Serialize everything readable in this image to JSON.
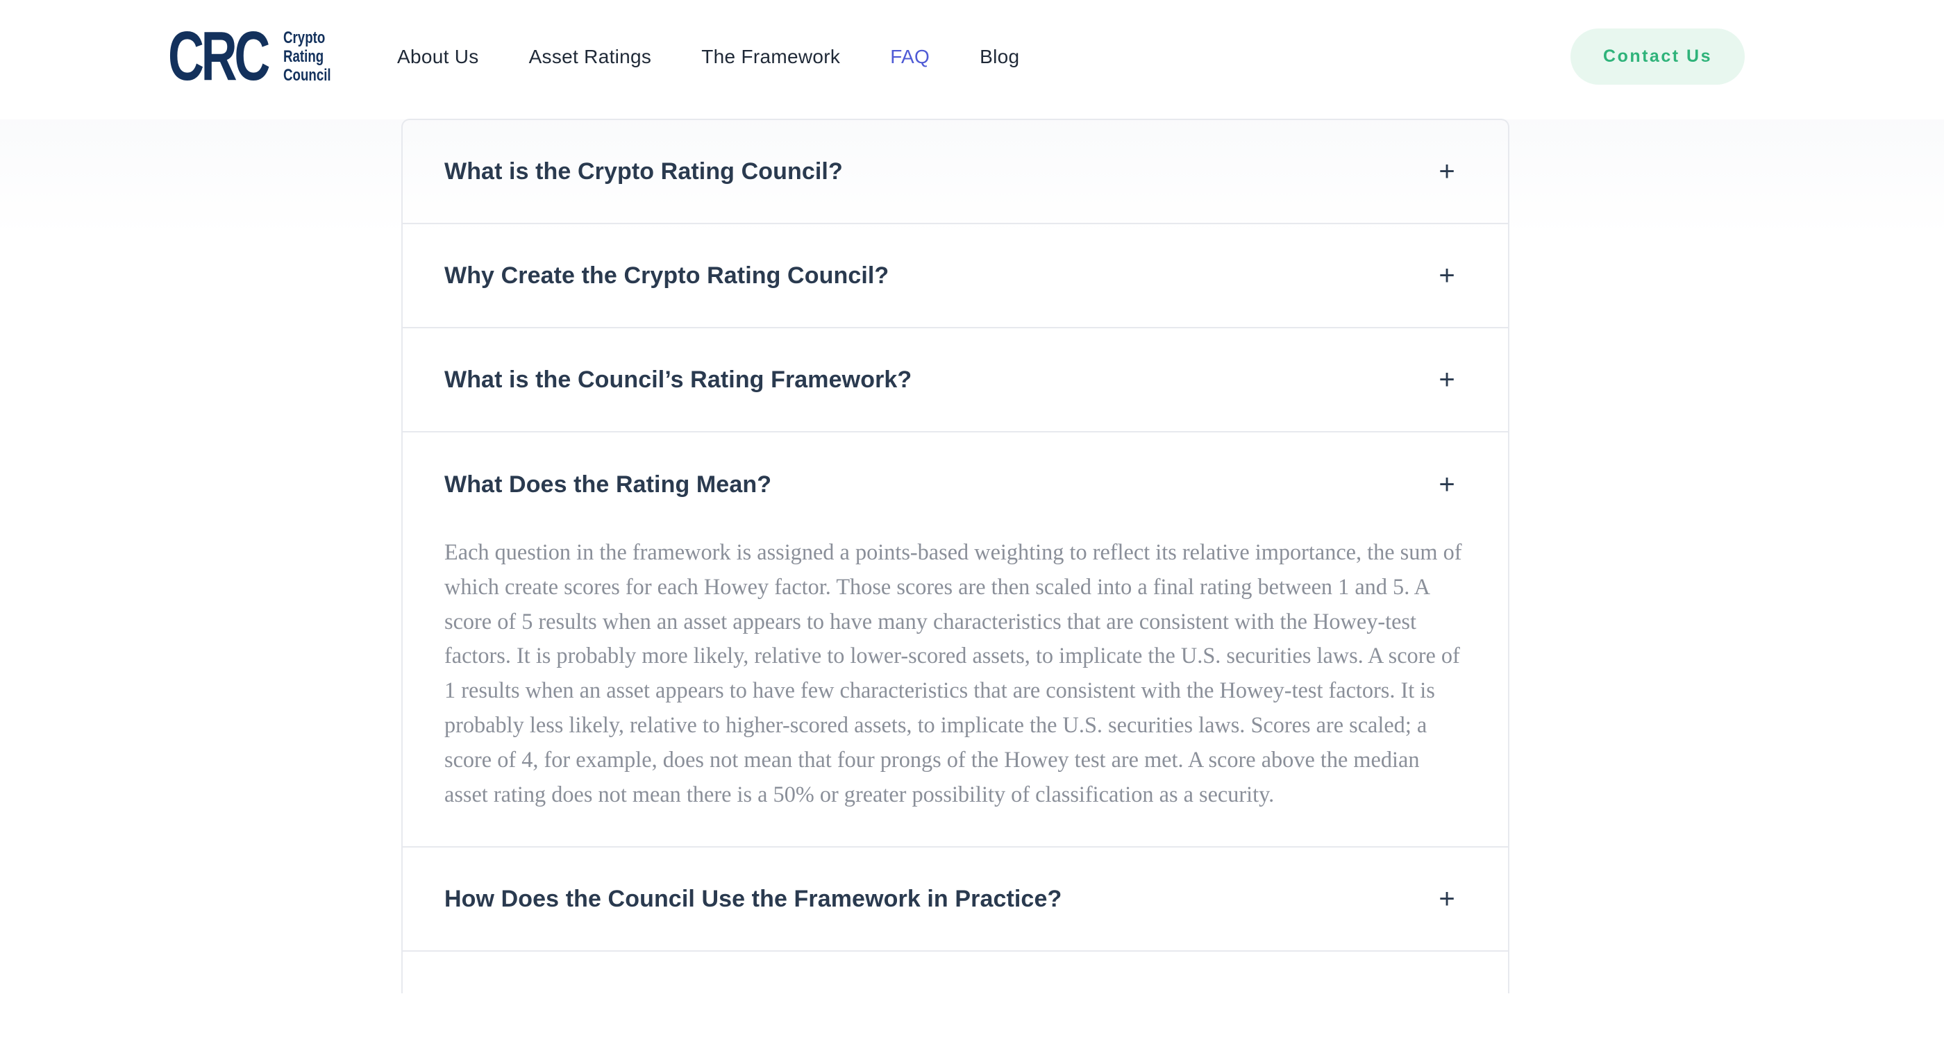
{
  "brand": {
    "logo_mark": "CRC",
    "logo_words": [
      "Crypto",
      "Rating",
      "Council"
    ]
  },
  "nav": {
    "items": [
      {
        "label": "About Us",
        "active": false
      },
      {
        "label": "Asset Ratings",
        "active": false
      },
      {
        "label": "The Framework",
        "active": false
      },
      {
        "label": "FAQ",
        "active": true
      },
      {
        "label": "Blog",
        "active": false
      }
    ],
    "contact_label": "Contact Us"
  },
  "faq": {
    "items": [
      {
        "question": "What is the Crypto Rating Council?",
        "icon": "plus-icon",
        "open": false
      },
      {
        "question": "Why Create the Crypto Rating Council?",
        "icon": "plus-icon",
        "open": false
      },
      {
        "question": "What is the Council’s Rating Framework?",
        "icon": "plus-icon",
        "open": false
      },
      {
        "question": "What Does the Rating Mean?",
        "icon": "plus-icon",
        "open": true,
        "answer": "Each question in the framework is assigned a points-based weighting to reflect its relative importance, the sum of which create scores for each Howey factor. Those scores are then scaled into a final rating between 1 and 5. A score of 5 results when an asset appears to have many characteristics that are consistent with the Howey-test factors. It is probably more likely, relative to lower-scored assets, to implicate the U.S. securities laws. A score of 1 results when an asset appears to have few characteristics that are consistent with the Howey-test factors. It is probably less likely, relative to higher-scored assets, to implicate the U.S. securities laws. Scores are scaled; a score of 4, for example, does not mean that four prongs of the Howey test are met. A score above the median asset rating does not mean there is a 50% or greater possibility of classification as a security."
      },
      {
        "question": "How Does the Council Use the Framework in Practice?",
        "icon": "plus-icon",
        "open": false
      }
    ],
    "plus_glyph": "+"
  },
  "colors": {
    "brand_navy": "#13315c",
    "nav_active": "#4f5bd5",
    "contact_text": "#2fb37a",
    "contact_bg": "#e8f7ef",
    "question_text": "#2a3a4f",
    "answer_text": "#8a8f99"
  }
}
